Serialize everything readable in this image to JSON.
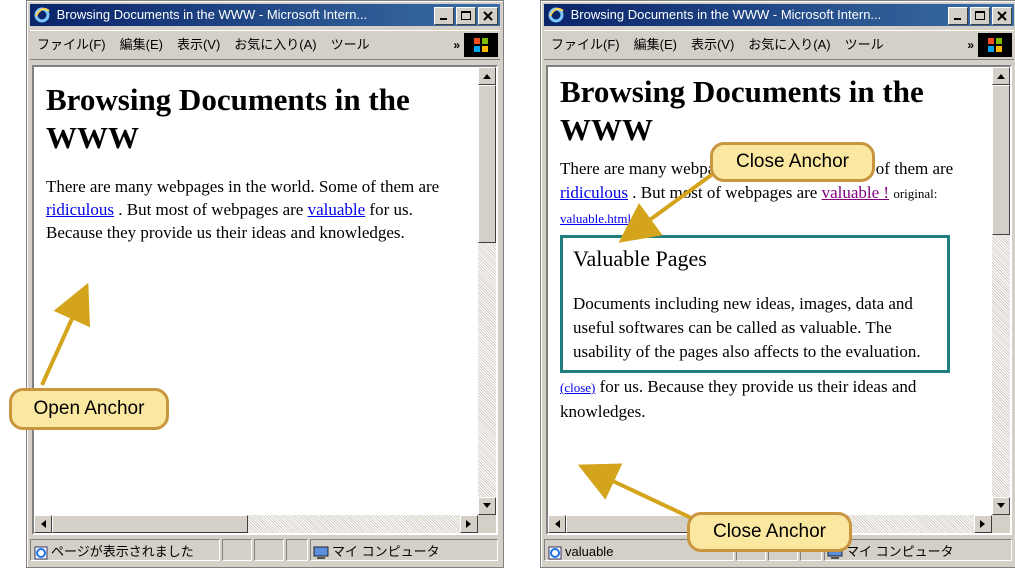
{
  "left_window": {
    "title": "Browsing Documents in the WWW - Microsoft Intern...",
    "menu": [
      "ファイル(F)",
      "編集(E)",
      "表示(V)",
      "お気に入り(A)",
      "ツール"
    ],
    "menu_more": "»",
    "page": {
      "heading": "Browsing Documents in the WWW",
      "p_before": "There are many webpages in the world. Some of them are ",
      "link_ridiculous": "ridiculous",
      "p_mid": " . But most of webpages are ",
      "link_valuable": "valuable",
      "p_after": " for us. Because they provide us their ideas and knowledges."
    },
    "status": {
      "text": "ページが表示されました",
      "zone": "マイ コンピュータ"
    }
  },
  "right_window": {
    "title": "Browsing Documents in the WWW - Microsoft Intern...",
    "menu": [
      "ファイル(F)",
      "編集(E)",
      "表示(V)",
      "お気に入り(A)",
      "ツール"
    ],
    "menu_more": "»",
    "page": {
      "heading": "Browsing Documents in the WWW",
      "p_before": "There are many webpages in the world. Some of them are ",
      "link_ridiculous": "ridiculous",
      "p_mid": " . But most of webpages are ",
      "link_valuable": "valuable !",
      "original_label": "original:",
      "original_link": "valuable.html",
      "box_title": "Valuable Pages",
      "box_text": "Documents including new ideas, images, data and useful softwares can be called as valuable. The usability of the pages also affects to the evaluation.",
      "close_link": "(close)",
      "p_after": " for us. Because they provide us their ideas and knowledges."
    },
    "status": {
      "text": "valuable",
      "zone": "マイ コンピュータ"
    }
  },
  "callouts": {
    "open_anchor": "Open Anchor",
    "close_anchor_top": "Close Anchor",
    "close_anchor_bottom": "Close Anchor"
  },
  "colors": {
    "callout_fill": "#fbe8a0",
    "callout_border": "#c9963f",
    "arrow": "#d4a51c",
    "box_border": "#1f7f7f"
  }
}
